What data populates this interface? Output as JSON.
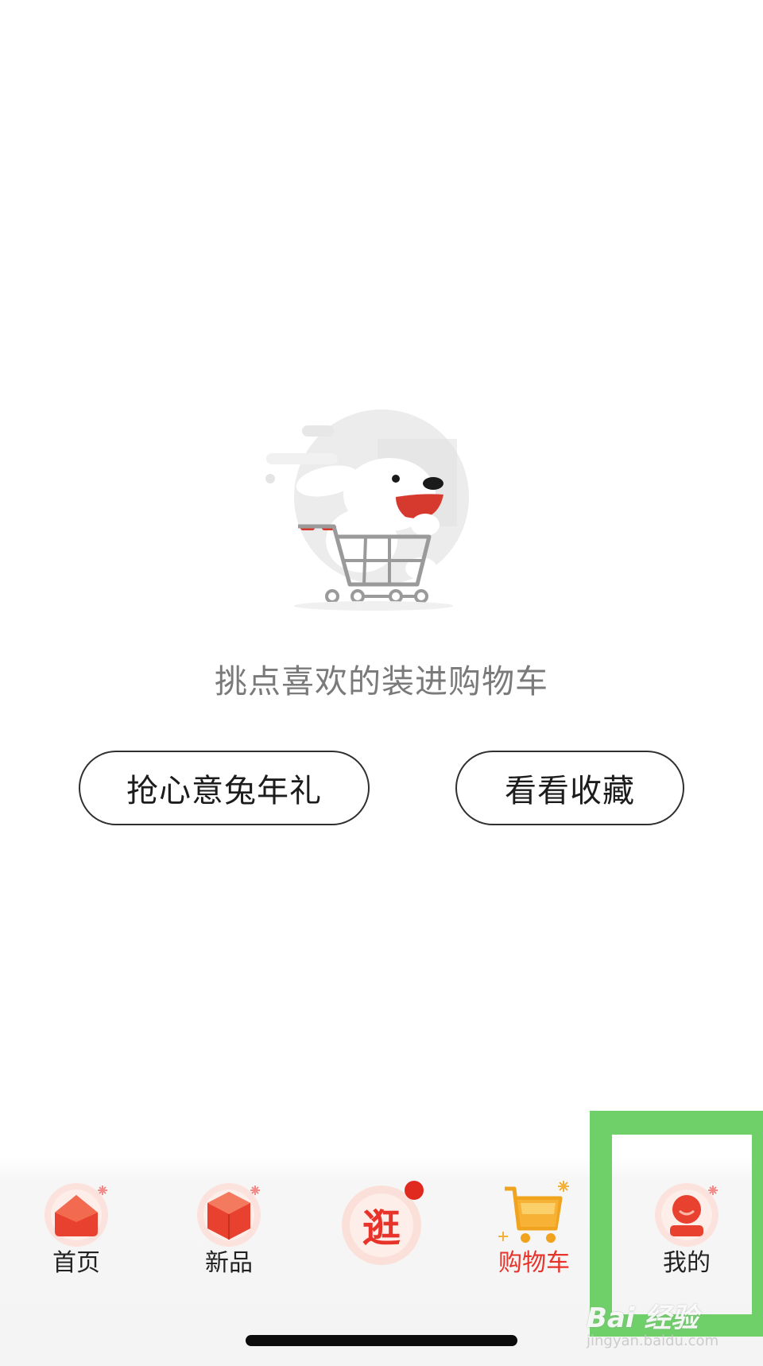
{
  "empty_state": {
    "illustration_icon": "joy-dog-shopping-cart-illustration",
    "message": "挑点喜欢的装进购物车",
    "buttons": {
      "gift": "抢心意兔年礼",
      "favorites": "看看收藏"
    }
  },
  "tabbar": {
    "tabs": [
      {
        "label": "首页",
        "icon": "home-house-icon",
        "active": false
      },
      {
        "label": "新品",
        "icon": "new-cube-icon",
        "active": false
      },
      {
        "label": "逛",
        "icon": "stroll-icon",
        "active": false,
        "badge": "red-dot"
      },
      {
        "label": "购物车",
        "icon": "shopping-cart-icon",
        "active": true
      },
      {
        "label": "我的",
        "icon": "profile-icon",
        "active": false
      }
    ]
  },
  "watermark": {
    "main": "Bai 经验",
    "sub": "jingyan.baidu.com"
  },
  "colors": {
    "accent": "#e8332a",
    "highlight": "#6fd06a",
    "text_muted": "#7a7a7a"
  }
}
